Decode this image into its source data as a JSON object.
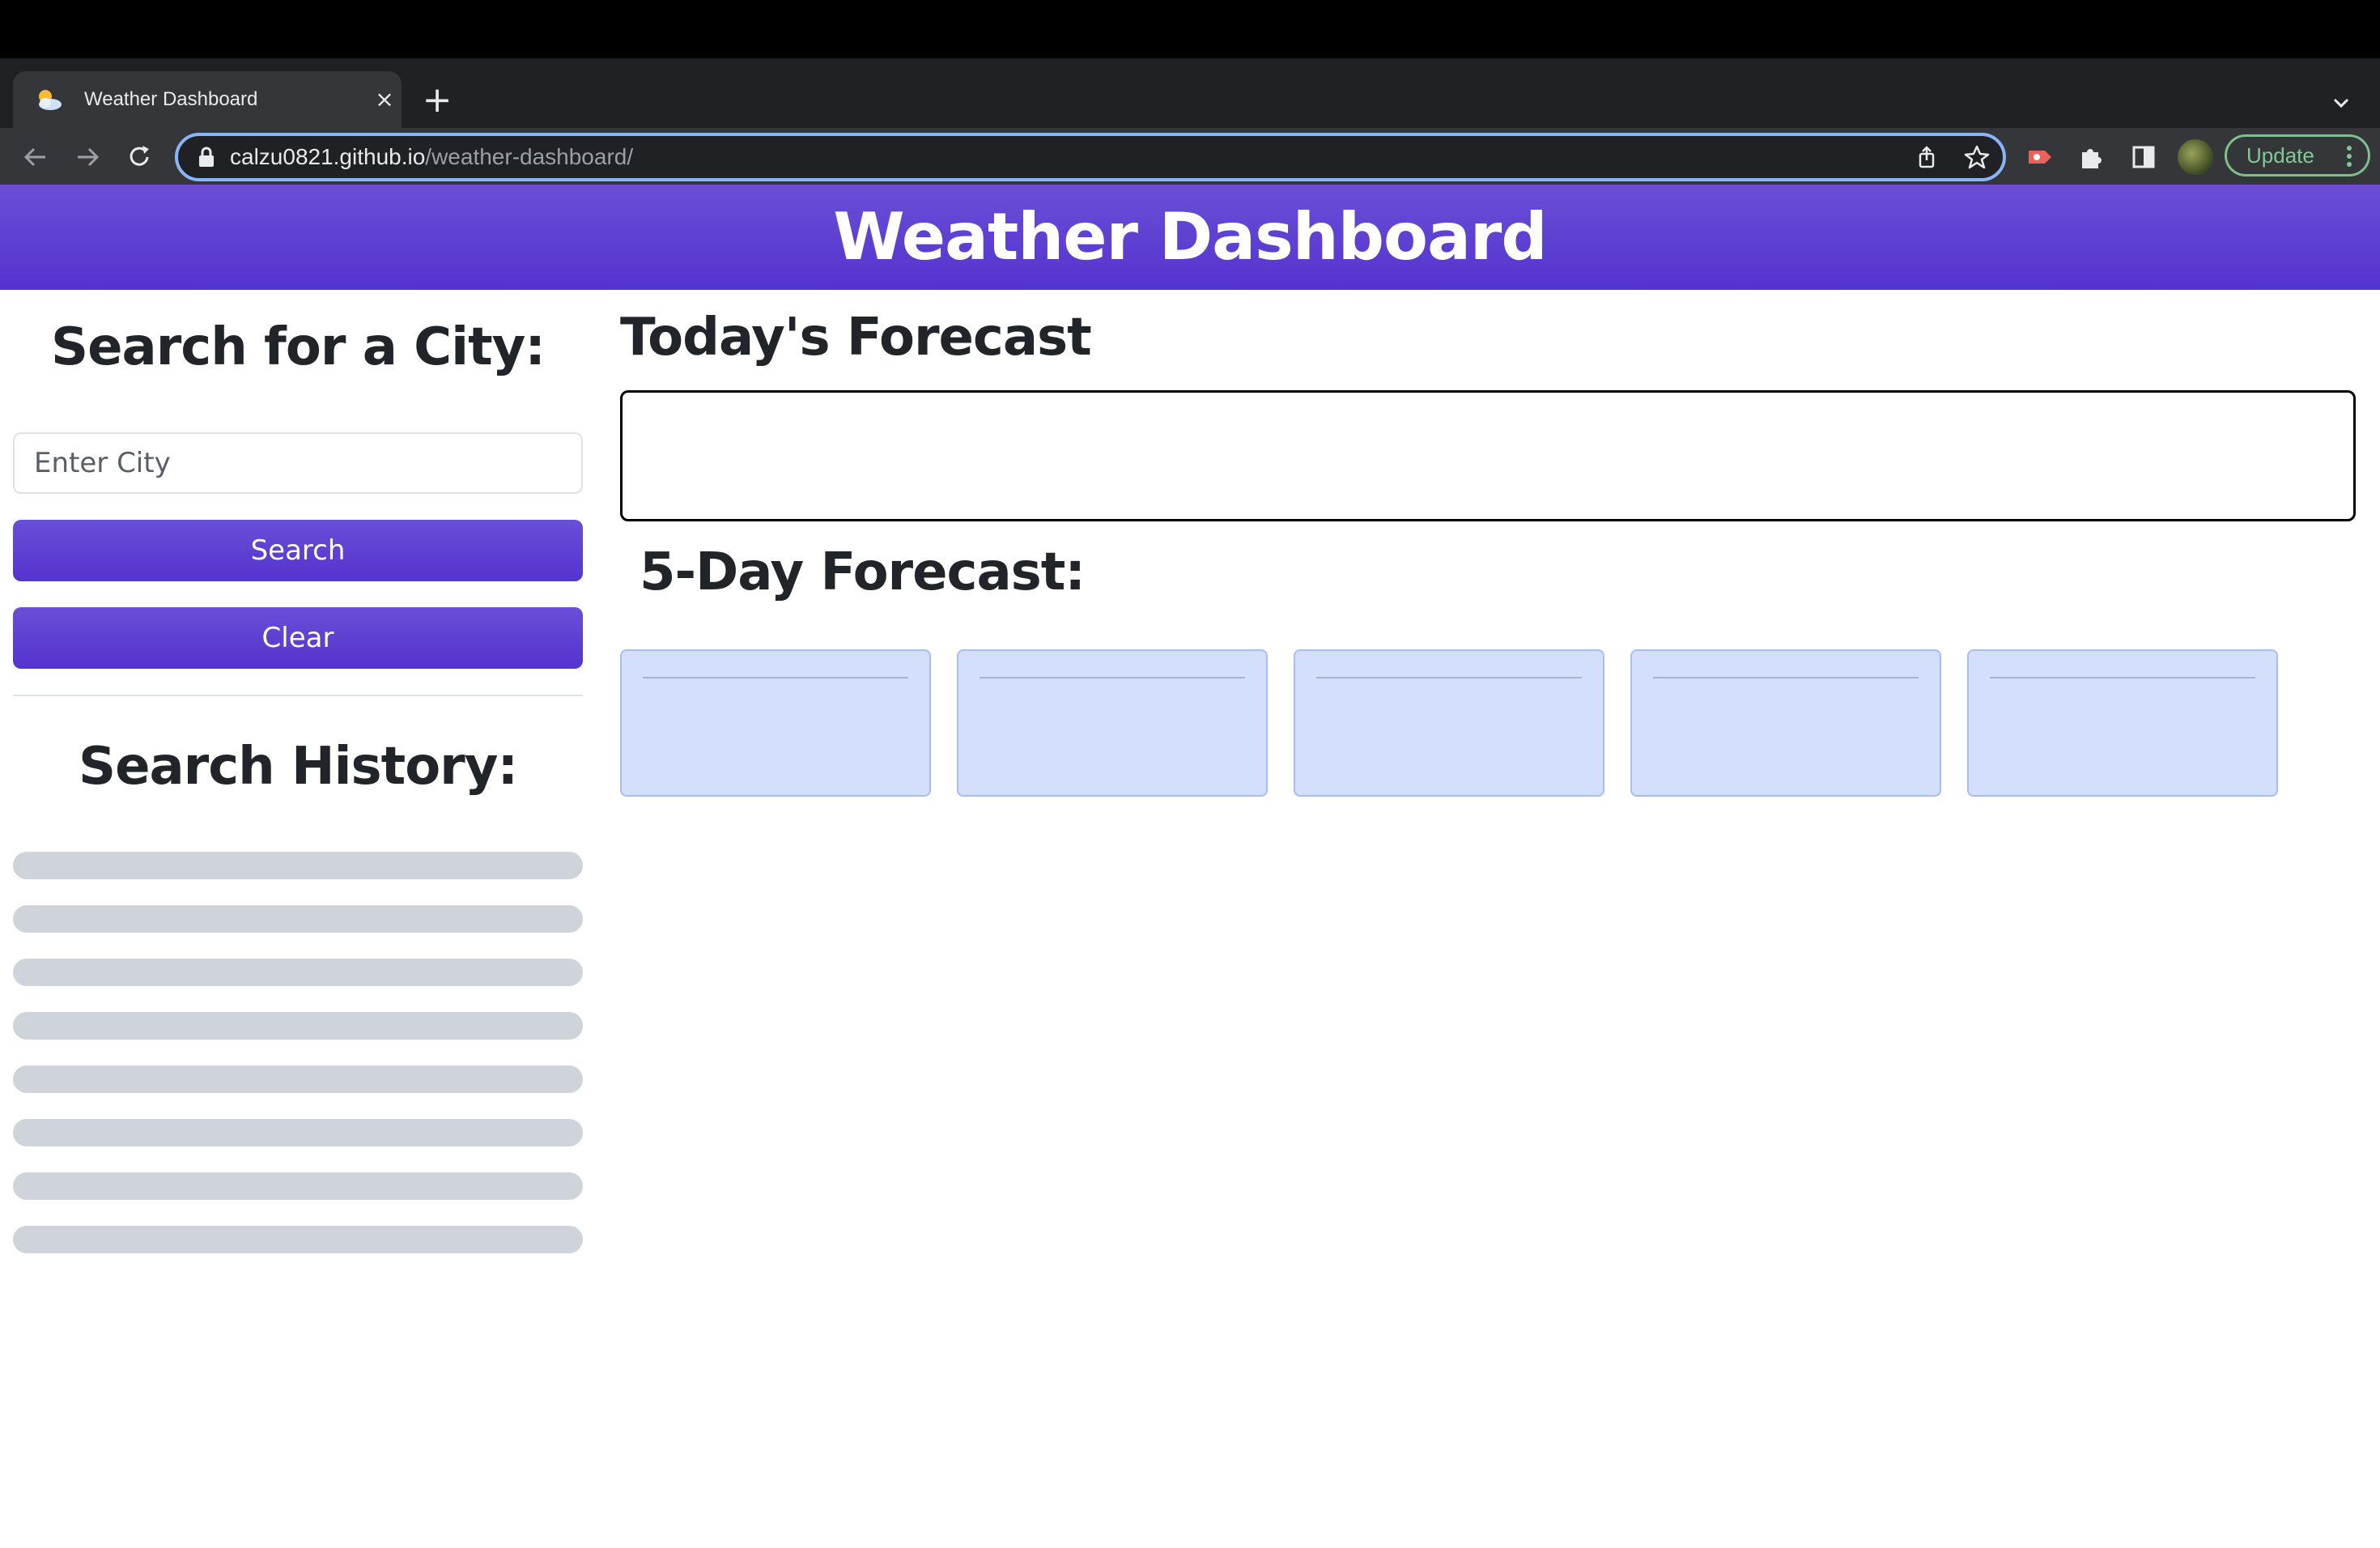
{
  "browser": {
    "tab_title": "Weather Dashboard",
    "close_symbol": "×",
    "new_tab_symbol": "+",
    "url_host": "calzu0821.github.io",
    "url_path": "/weather-dashboard/",
    "update_label": "Update"
  },
  "header": {
    "title": "Weather Dashboard"
  },
  "sidebar": {
    "search_heading": "Search for a City:",
    "city_placeholder": "Enter City",
    "search_label": "Search",
    "clear_label": "Clear",
    "history_heading": "Search History:",
    "history_items": [
      "",
      "",
      "",
      "",
      "",
      "",
      "",
      ""
    ]
  },
  "main": {
    "today_heading": "Today's Forecast",
    "five_day_heading": "5-Day Forecast:",
    "day_cards": [
      "",
      "",
      "",
      "",
      ""
    ]
  },
  "colors": {
    "accent": "#5433cf",
    "card_bg": "#d4e0fb",
    "history_bg": "#ced4da"
  }
}
